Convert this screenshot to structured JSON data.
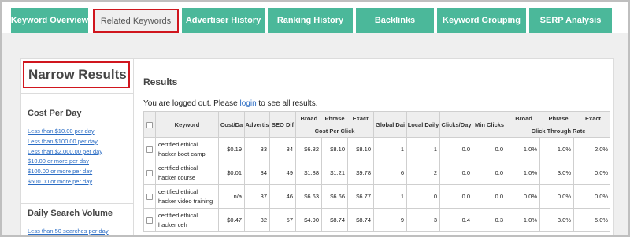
{
  "tabs": [
    {
      "label": "Keyword Overview",
      "active": false
    },
    {
      "label": "Related Keywords",
      "active": true
    },
    {
      "label": "Advertiser History",
      "active": false
    },
    {
      "label": "Ranking History",
      "active": false
    },
    {
      "label": "Backlinks",
      "active": false
    },
    {
      "label": "Keyword Grouping",
      "active": false
    },
    {
      "label": "SERP Analysis",
      "active": false
    }
  ],
  "sidebar": {
    "title": "Narrow Results",
    "cost_per_day": {
      "heading": "Cost Per Day",
      "links": [
        "Less than $10.00 per day",
        "Less than $100.00 per day",
        "Less than $2,000.00 per day",
        "$10.00 or more per day",
        "$100.00 or more per day",
        "$500.00 or more per day"
      ]
    },
    "daily_search_volume": {
      "heading": "Daily Search Volume",
      "links": [
        "Less than 50 searches per day"
      ]
    }
  },
  "results": {
    "title": "Results",
    "logged_out_prefix": "You are logged out. Please ",
    "login_link": "login",
    "logged_out_suffix": " to see all results.",
    "table": {
      "headers": {
        "keyword": "Keyword",
        "cost_day": "Cost/Da",
        "advertisers": "Advertis",
        "seo_dif": "SEO Dif",
        "cpc_broad": "Broad",
        "cpc_phrase": "Phrase",
        "cpc_exact": "Exact",
        "cpc_group": "Cost Per Click",
        "global_daily": "Global Dai",
        "local_daily": "Local Daily",
        "clicks_day": "Clicks/Day",
        "min_clicks": "Min Clicks",
        "ctr_broad": "Broad",
        "ctr_phrase": "Phrase",
        "ctr_exact": "Exact",
        "ctr_group": "Click Through Rate"
      },
      "rows": [
        {
          "keyword": "certified ethical hacker boot camp",
          "cost_day": "$0.19",
          "advertisers": "33",
          "seo_dif": "34",
          "cpc_broad": "$6.82",
          "cpc_phrase": "$8.10",
          "cpc_exact": "$8.10",
          "global_daily": "1",
          "local_daily": "1",
          "clicks_day": "0.0",
          "min_clicks": "0.0",
          "ctr_broad": "1.0%",
          "ctr_phrase": "1.0%",
          "ctr_exact": "2.0%"
        },
        {
          "keyword": "certified ethical hacker course",
          "cost_day": "$0.01",
          "advertisers": "34",
          "seo_dif": "49",
          "cpc_broad": "$1.88",
          "cpc_phrase": "$1.21",
          "cpc_exact": "$9.78",
          "global_daily": "6",
          "local_daily": "2",
          "clicks_day": "0.0",
          "min_clicks": "0.0",
          "ctr_broad": "1.0%",
          "ctr_phrase": "3.0%",
          "ctr_exact": "0.0%"
        },
        {
          "keyword": "certified ethical hacker video training",
          "cost_day": "n/a",
          "advertisers": "37",
          "seo_dif": "46",
          "cpc_broad": "$6.63",
          "cpc_phrase": "$6.66",
          "cpc_exact": "$6.77",
          "global_daily": "1",
          "local_daily": "0",
          "clicks_day": "0.0",
          "min_clicks": "0.0",
          "ctr_broad": "0.0%",
          "ctr_phrase": "0.0%",
          "ctr_exact": "0.0%"
        },
        {
          "keyword": "certified ethical hacker ceh",
          "cost_day": "$0.47",
          "advertisers": "32",
          "seo_dif": "57",
          "cpc_broad": "$4.90",
          "cpc_phrase": "$8.74",
          "cpc_exact": "$8.74",
          "global_daily": "9",
          "local_daily": "3",
          "clicks_day": "0.4",
          "min_clicks": "0.3",
          "ctr_broad": "1.0%",
          "ctr_phrase": "3.0%",
          "ctr_exact": "5.0%"
        }
      ]
    }
  }
}
